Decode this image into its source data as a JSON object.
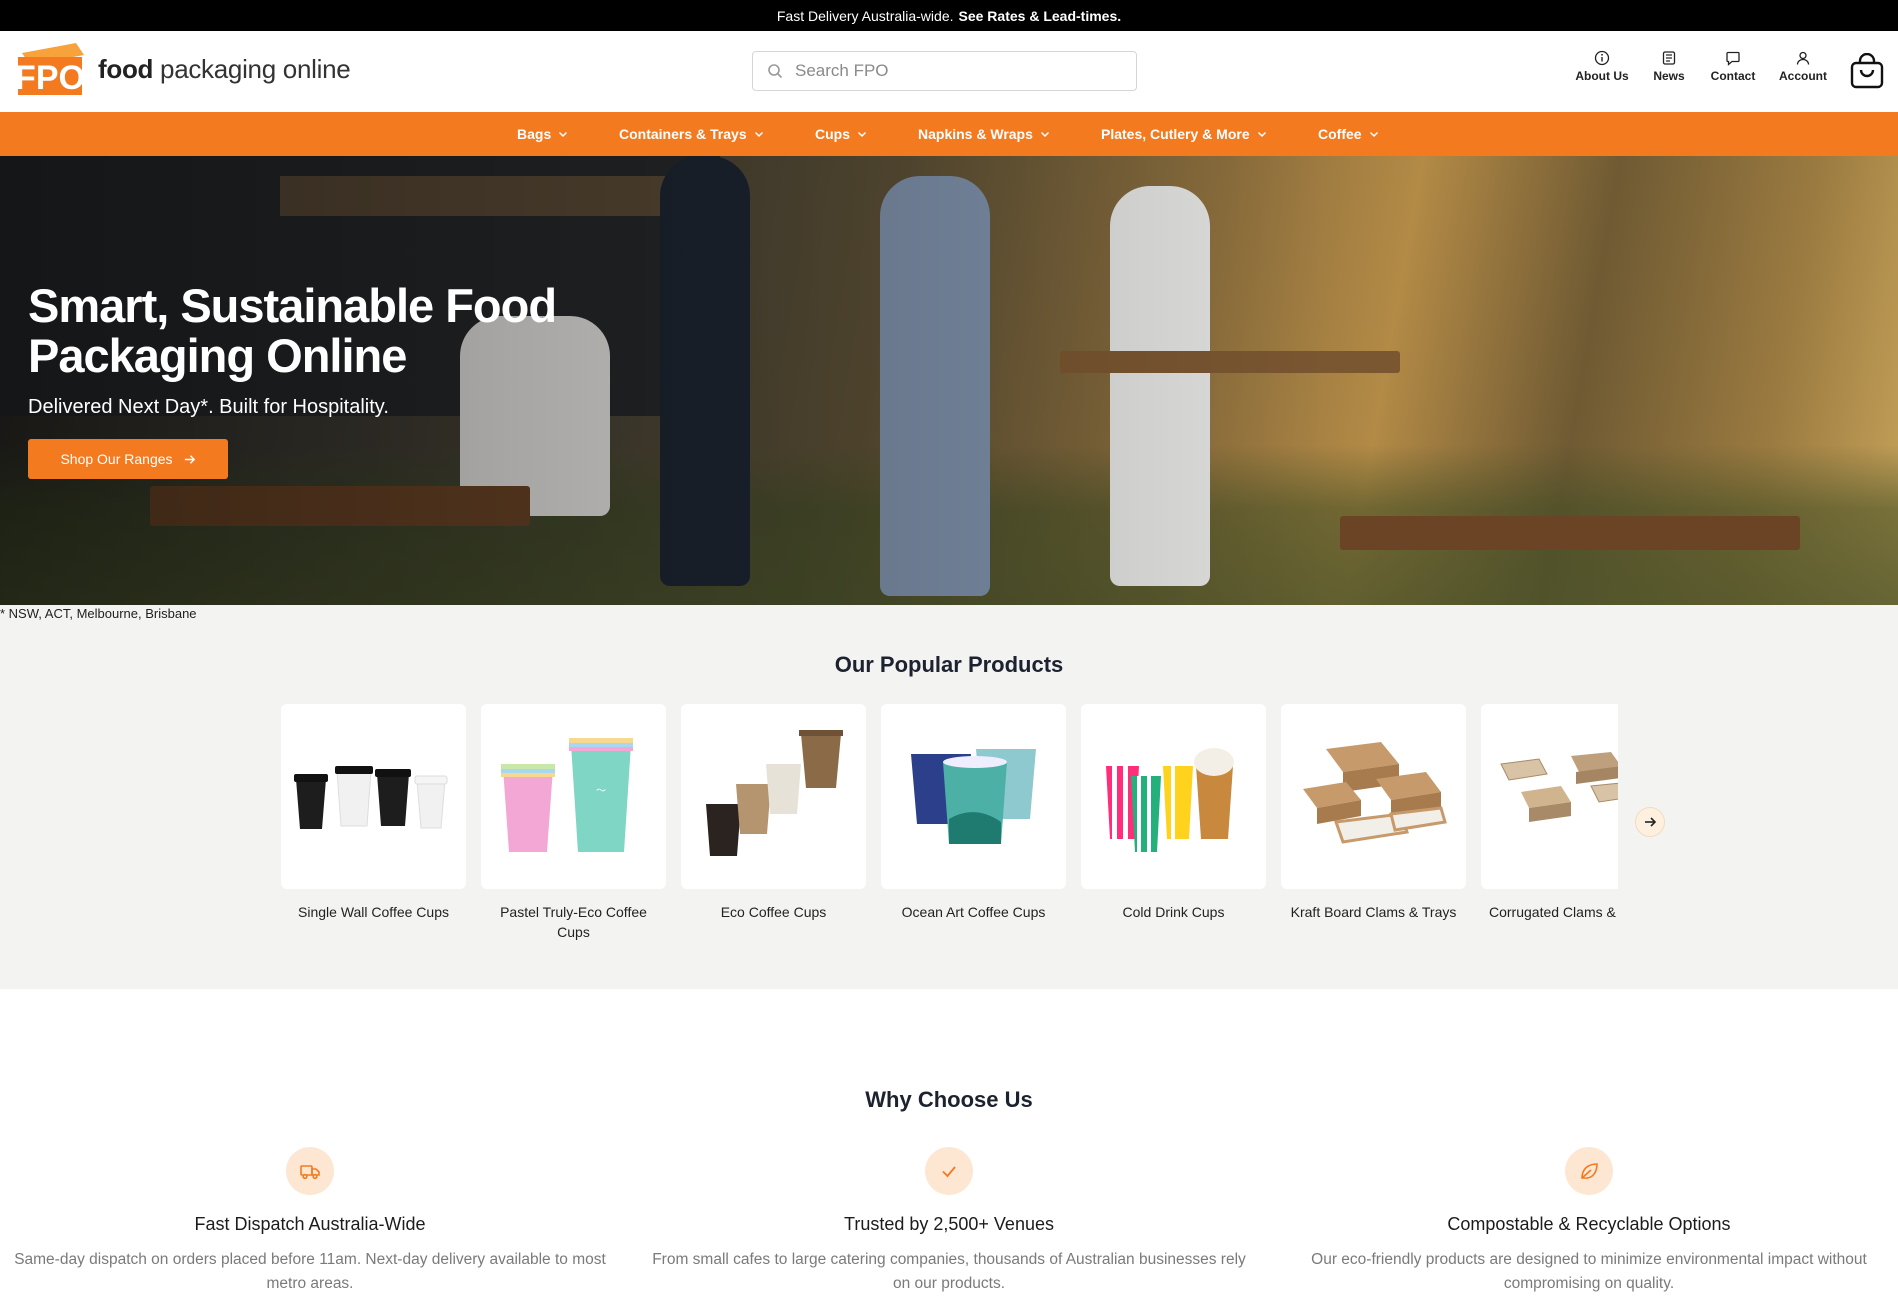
{
  "announcement": {
    "text": "Fast Delivery Australia-wide.",
    "link": "See Rates & Lead-times."
  },
  "header": {
    "logo_mark": "FPO",
    "logo_bold": "food",
    "logo_rest": " packaging online",
    "search_placeholder": "Search FPO",
    "utilities": [
      {
        "label": "About Us",
        "icon": "info-icon"
      },
      {
        "label": "News",
        "icon": "news-icon"
      },
      {
        "label": "Contact",
        "icon": "chat-icon"
      },
      {
        "label": "Account",
        "icon": "user-icon"
      }
    ],
    "cart_icon": "shopping-bag-icon"
  },
  "nav": {
    "items": [
      {
        "label": "Bags"
      },
      {
        "label": "Containers & Trays"
      },
      {
        "label": "Cups"
      },
      {
        "label": "Napkins & Wraps"
      },
      {
        "label": "Plates, Cutlery & More"
      },
      {
        "label": "Coffee"
      }
    ]
  },
  "hero": {
    "title": "Smart, Sustainable Food Packaging Online",
    "subtitle": "Delivered Next Day*. Built for Hospitality.",
    "button": "Shop Our Ranges",
    "footnote": "* NSW, ACT, Melbourne, Brisbane"
  },
  "popular": {
    "title": "Our Popular Products",
    "products": [
      {
        "name": "Single Wall Coffee Cups",
        "name2": ""
      },
      {
        "name": "Pastel Truly-Eco Coffee",
        "name2": "Cups"
      },
      {
        "name": "Eco Coffee Cups",
        "name2": ""
      },
      {
        "name": "Ocean Art Coffee Cups",
        "name2": ""
      },
      {
        "name": "Cold Drink Cups",
        "name2": ""
      },
      {
        "name": "Kraft Board Clams & Trays",
        "name2": ""
      },
      {
        "name": "Corrugated Clams & Trays",
        "name2": ""
      }
    ]
  },
  "why": {
    "title": "Why Choose Us",
    "features": [
      {
        "icon": "truck-icon",
        "title": "Fast Dispatch Australia-Wide",
        "desc": "Same-day dispatch on orders placed before 11am. Next-day delivery available to most metro areas."
      },
      {
        "icon": "check-icon",
        "title": "Trusted by 2,500+ Venues",
        "desc": "From small cafes to large catering companies, thousands of Australian businesses rely on our products."
      },
      {
        "icon": "leaf-icon",
        "title": "Compostable & Recyclable Options",
        "desc": "Our eco-friendly products are designed to minimize environmental impact without compromising on quality."
      }
    ]
  },
  "colors": {
    "brand_orange": "#f47a20",
    "announce_bg": "#000000",
    "section_bg": "#f3f3f1"
  }
}
